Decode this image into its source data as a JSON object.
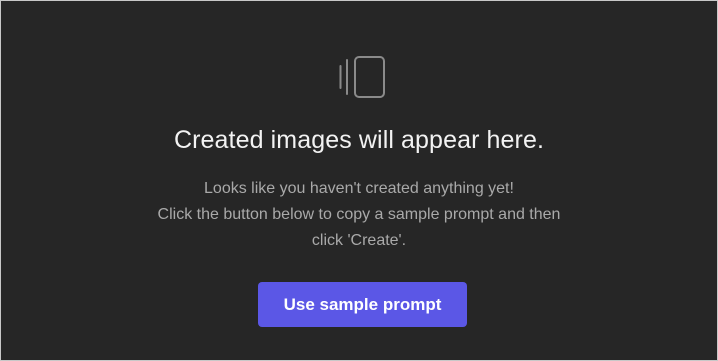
{
  "empty_state": {
    "icon": "image-stack-icon",
    "title": "Created images will appear here.",
    "description_lines": [
      "Looks like you haven't created anything yet!",
      "Click the button below to copy a sample prompt and then",
      "click 'Create'."
    ],
    "button_label": "Use sample prompt"
  },
  "colors": {
    "background": "#262626",
    "title": "#f2f2f2",
    "description": "#a9a9a9",
    "accent": "#5b57e6",
    "icon": "#8a8a8a"
  }
}
